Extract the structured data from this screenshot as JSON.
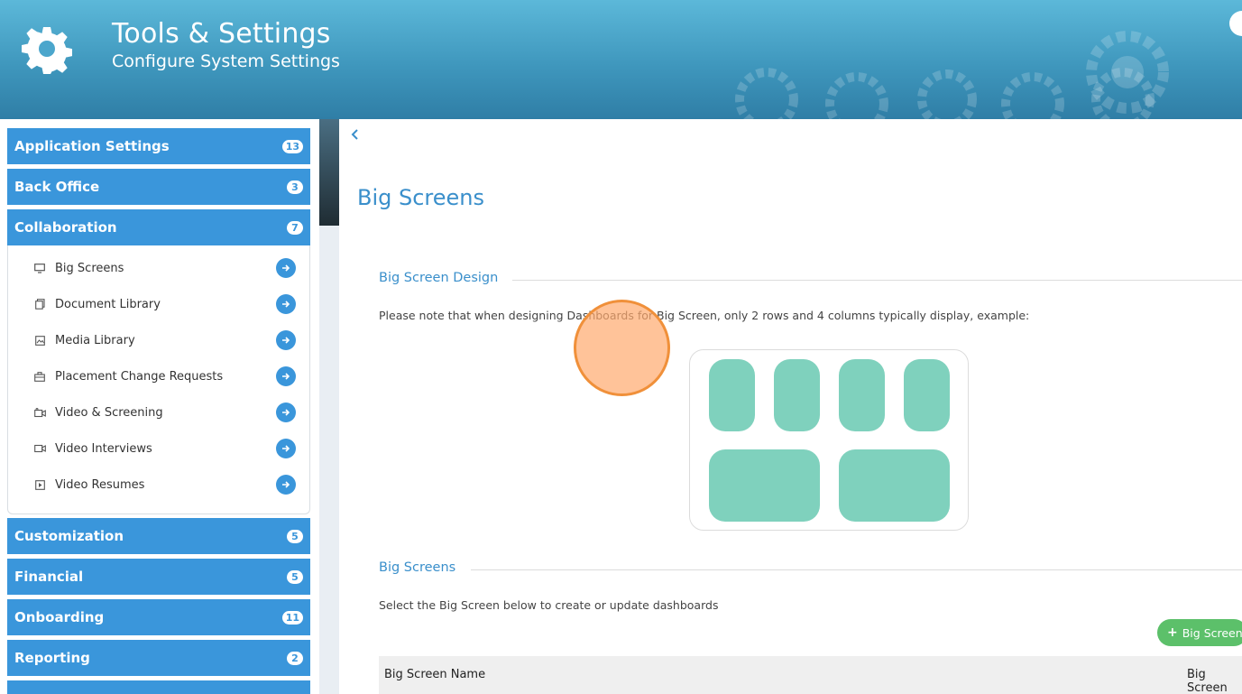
{
  "header": {
    "title": "Tools & Settings",
    "subtitle": "Configure System Settings",
    "icon": "gear-icon"
  },
  "sidebar": {
    "categories": [
      {
        "label": "Application Settings",
        "count": "13"
      },
      {
        "label": "Back Office",
        "count": "3"
      },
      {
        "label": "Collaboration",
        "count": "7"
      },
      {
        "label": "Customization",
        "count": "5"
      },
      {
        "label": "Financial",
        "count": "5"
      },
      {
        "label": "Onboarding",
        "count": "11"
      },
      {
        "label": "Reporting",
        "count": "2"
      }
    ],
    "collaboration_items": [
      {
        "label": "Big Screens",
        "icon": "monitor-icon"
      },
      {
        "label": "Document Library",
        "icon": "documents-icon"
      },
      {
        "label": "Media Library",
        "icon": "image-icon"
      },
      {
        "label": "Placement Change Requests",
        "icon": "briefcase-icon"
      },
      {
        "label": "Video & Screening",
        "icon": "video-camera-icon"
      },
      {
        "label": "Video Interviews",
        "icon": "video-icon"
      },
      {
        "label": "Video Resumes",
        "icon": "play-icon"
      }
    ]
  },
  "main": {
    "page_title": "Big Screens",
    "design_section": {
      "title": "Big Screen Design",
      "note": "Please note that when designing Dashboards for Big Screen, only 2 rows and 4 columns typically display, example:"
    },
    "list_section": {
      "title": "Big Screens",
      "note": "Select the Big Screen below to create or update dashboards",
      "add_button": "Big Screen"
    },
    "table": {
      "columns": [
        "Big Screen Name",
        "Big Screen"
      ]
    }
  },
  "colors": {
    "accent": "#3a96db",
    "tile": "#7fd1bd",
    "add_button": "#5cc06a",
    "title_blue": "#3a8fcb"
  }
}
